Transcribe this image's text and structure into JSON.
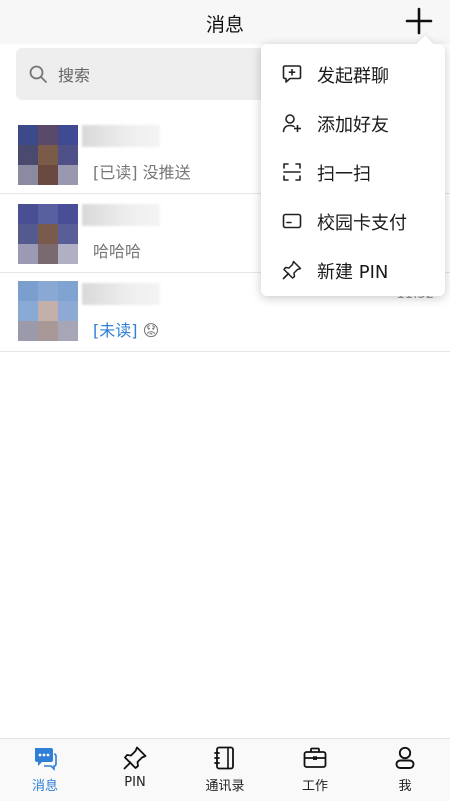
{
  "header": {
    "title": "消息"
  },
  "search": {
    "placeholder": "搜索"
  },
  "conversations": [
    {
      "preview_prefix": "[已读]",
      "preview_text": " 没推送",
      "time": ""
    },
    {
      "preview_prefix": "",
      "preview_text": "哈哈哈",
      "time": ""
    },
    {
      "preview_prefix": "[未读]",
      "preview_text": " 😟",
      "time": "11:52"
    }
  ],
  "dropdown_menu": {
    "items": [
      {
        "label": "发起群聊",
        "icon": "chat-plus-icon"
      },
      {
        "label": "添加好友",
        "icon": "add-friend-icon"
      },
      {
        "label": "扫一扫",
        "icon": "scan-icon"
      },
      {
        "label": "校园卡支付",
        "icon": "card-icon"
      },
      {
        "label": "新建 PIN",
        "icon": "pin-icon"
      }
    ]
  },
  "tabbar": {
    "tabs": [
      {
        "label": "消息",
        "icon": "messages-icon",
        "active": true
      },
      {
        "label": "PIN",
        "icon": "pin-icon",
        "active": false
      },
      {
        "label": "通讯录",
        "icon": "contacts-icon",
        "active": false
      },
      {
        "label": "工作",
        "icon": "briefcase-icon",
        "active": false
      },
      {
        "label": "我",
        "icon": "profile-icon",
        "active": false
      }
    ]
  },
  "colors": {
    "accent": "#2f7fd6",
    "header_bg": "#f7f7f7",
    "search_bg": "#eeeeee"
  }
}
